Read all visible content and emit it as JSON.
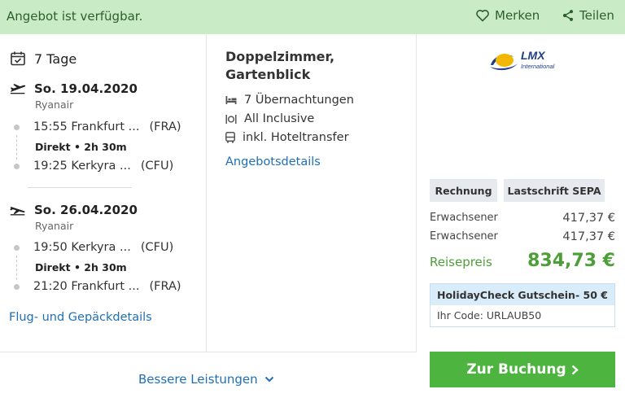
{
  "topbar": {
    "availability": "Angebot ist verfügbar.",
    "save_label": "Merken",
    "share_label": "Teilen"
  },
  "trip": {
    "duration": "7 Tage",
    "outbound": {
      "date": "So. 19.04.2020",
      "airline": "Ryanair",
      "depart_time": "15:55",
      "depart_city": "Frankfurt ...",
      "depart_code": "(FRA)",
      "direct": "Direkt",
      "duration": "2h 30m",
      "arrive_time": "19:25",
      "arrive_city": "Kerkyra ...",
      "arrive_code": "(CFU)"
    },
    "return": {
      "date": "So. 26.04.2020",
      "airline": "Ryanair",
      "depart_time": "19:50",
      "depart_city": "Kerkyra ...",
      "depart_code": "(CFU)",
      "direct": "Direkt",
      "duration": "2h 30m",
      "arrive_time": "21:20",
      "arrive_city": "Frankfurt ...",
      "arrive_code": "(FRA)"
    },
    "details_link": "Flug- und Gepäckdetails"
  },
  "hotel": {
    "room_line1": "Doppelzimmer,",
    "room_line2": "Gartenblick",
    "nights": "7 Übernachtungen",
    "board": "All Inclusive",
    "transfer": "inkl. Hoteltransfer",
    "details_link": "Angebotsdetails"
  },
  "offer": {
    "logo_text": "LMX",
    "logo_subtext": "International",
    "payment_methods": [
      "Rechnung",
      "Lastschrift SEPA"
    ],
    "travelers": [
      {
        "label": "Erwachsener",
        "price": "417,37 €"
      },
      {
        "label": "Erwachsener",
        "price": "417,37 €"
      }
    ],
    "total_label": "Reisepreis",
    "total_price": "834,73 €",
    "voucher_title": "HolidayCheck Gutschein",
    "voucher_discount": "- 50 €",
    "voucher_code": "Ihr Code: URLAUB50",
    "book_label": "Zur Buchung"
  },
  "more": {
    "label": "Bessere Leistungen"
  },
  "colors": {
    "banner_bg": "#c9ecc6",
    "link_blue": "#1f6fb5",
    "price_green": "#4c9f38",
    "button_green": "#4db43f"
  }
}
